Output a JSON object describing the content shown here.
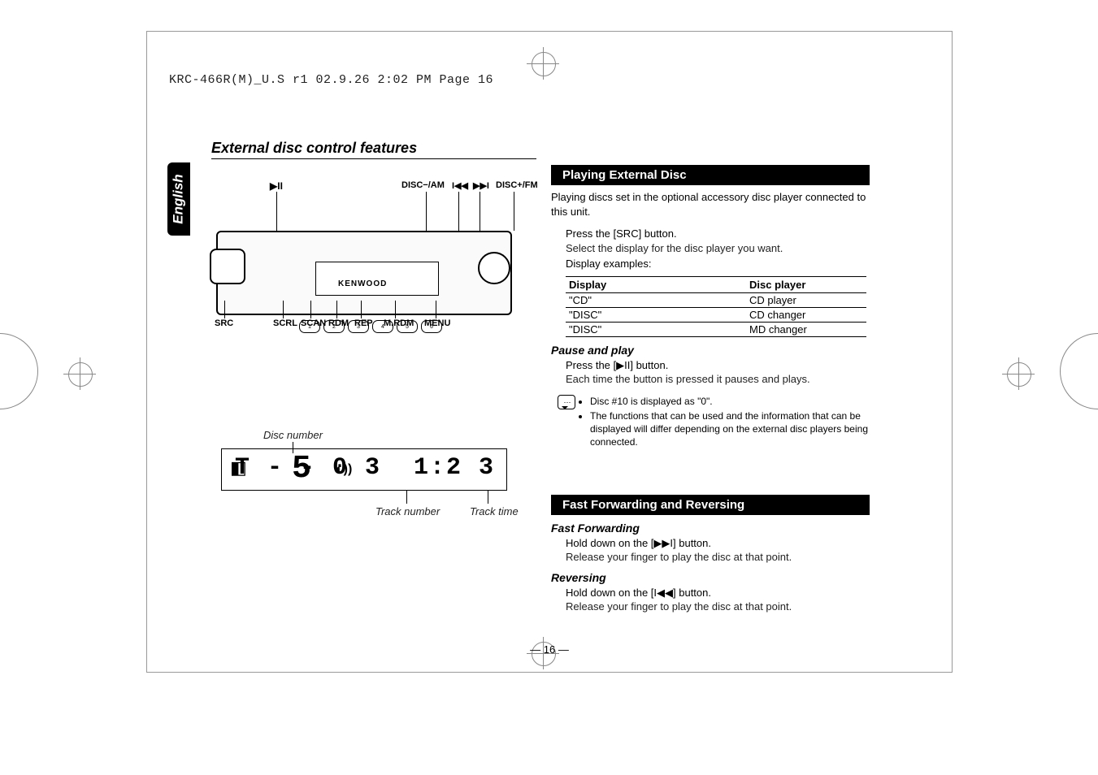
{
  "print_header": "KRC-466R(M)_U.S r1  02.9.26  2:02 PM  Page 16",
  "language_tab": "English",
  "section_title": "External disc control features",
  "diagram": {
    "brand": "KENWOOD",
    "top_labels": {
      "play_pause": "▶II",
      "disc_minus": "DISC−/AM",
      "prev": "I◀◀",
      "next": "▶▶I",
      "disc_plus": "DISC+/FM"
    },
    "bottom_labels": {
      "src": "SRC",
      "scrl": "SCRL",
      "scan": "SCAN",
      "rdm": "RDM",
      "rep": "REP",
      "mrdm": "M.RDM",
      "menu": "MENU"
    },
    "preset_buttons": [
      "1",
      "2",
      "3",
      "4",
      "5",
      "6"
    ]
  },
  "lcd": {
    "disc_number_label": "Disc number",
    "disc_digit": "5",
    "track_segment": "T - - 0 3",
    "time_segment": "1:2 3",
    "cd_icon": "◐))",
    "track_number_label": "Track number",
    "track_time_label": "Track time"
  },
  "playing_block": {
    "title": "Playing External Disc",
    "intro": "Playing discs set in the optional accessory disc player connected to this unit.",
    "step_lead": "Press the [SRC] button.",
    "step_sub": "Select the display for the disc player you want.",
    "examples_lead": "Display examples:",
    "table": {
      "headers": [
        "Display",
        "Disc player"
      ],
      "rows": [
        [
          "\"CD\"",
          "CD player"
        ],
        [
          "\"DISC\"",
          "CD changer"
        ],
        [
          "\"DISC\"",
          "MD changer"
        ]
      ]
    },
    "pause_subhead": "Pause and play",
    "pause_lead": "Press the [▶II] button.",
    "pause_sub": "Each time the button is pressed it pauses and plays.",
    "notes": [
      "Disc #10 is displayed as \"0\".",
      "The functions that can be used and the information that can be displayed will differ depending on the external disc players being connected."
    ]
  },
  "ff_block": {
    "title": "Fast Forwarding and Reversing",
    "ff_subhead": "Fast Forwarding",
    "ff_lead": "Hold down on the [▶▶I] button.",
    "ff_sub": "Release your finger to play the disc at that point.",
    "rev_subhead": "Reversing",
    "rev_lead": "Hold down on the [I◀◀] button.",
    "rev_sub": "Release your finger to play the disc at that point."
  },
  "page_number": "— 16 —"
}
